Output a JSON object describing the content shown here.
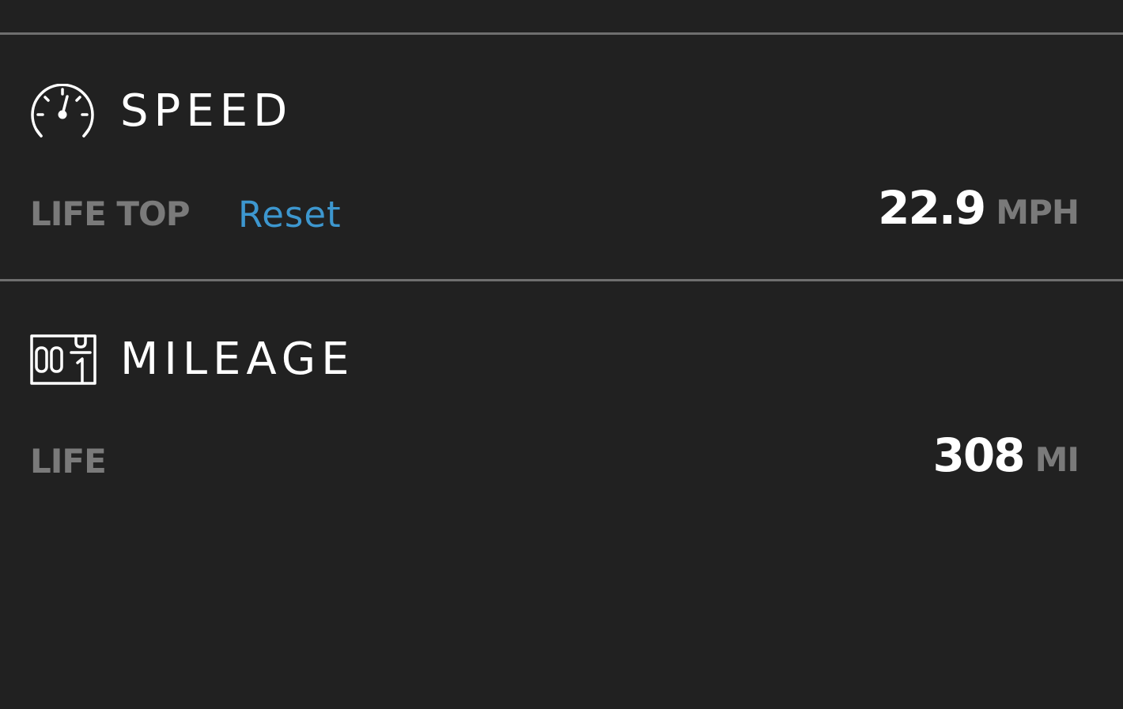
{
  "colors": {
    "background": "#212121",
    "divider": "#6f6f6f",
    "title_text": "#ffffff",
    "label_text": "#7a7a7a",
    "link": "#3d97cf"
  },
  "speed": {
    "icon": "speedometer-icon",
    "title": "SPEED",
    "stat_label": "LIFE TOP",
    "reset_label": "Reset",
    "value": "22.9",
    "unit": "MPH"
  },
  "mileage": {
    "icon": "odometer-icon",
    "title": "MILEAGE",
    "stat_label": "LIFE",
    "value": "308",
    "unit": "MI"
  }
}
